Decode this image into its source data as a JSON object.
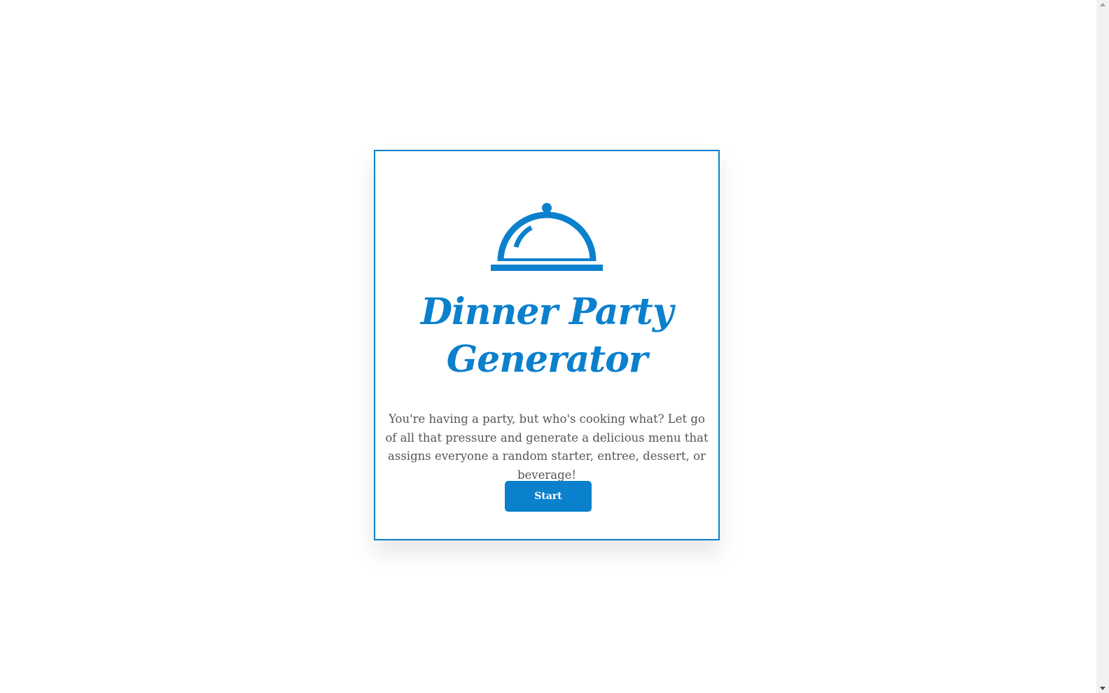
{
  "app": {
    "title_line1": "Dinner Party",
    "title_line2": "Generator",
    "description": "You're having a party, but who's cooking what? Let go of all that pressure and generate a delicious menu that assigns everyone a random starter, entree, dessert, or beverage!",
    "start_label": "Start",
    "icon": "cloche-icon"
  },
  "colors": {
    "accent": "#0b80cc",
    "text": "#555555",
    "background": "#ffffff"
  }
}
